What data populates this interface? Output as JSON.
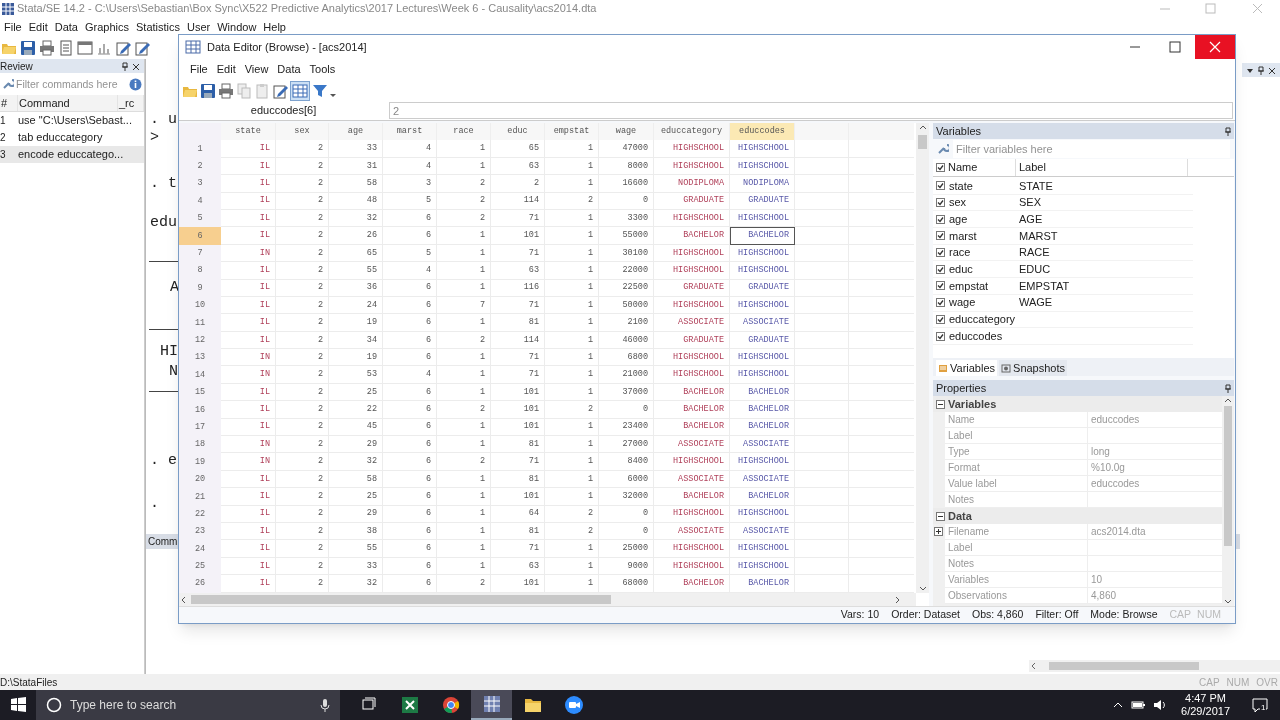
{
  "window": {
    "title": "Stata/SE 14.2 - C:\\Users\\Sebastian\\Box Sync\\X522 Predictive Analytics\\2017 Lectures\\Week 6 - Causality\\acs2014.dta",
    "menu": [
      "File",
      "Edit",
      "Data",
      "Graphics",
      "Statistics",
      "User",
      "Window",
      "Help"
    ]
  },
  "review": {
    "title": "Review",
    "filter_placeholder": "Filter commands here",
    "columns": [
      "#",
      "Command",
      "_rc"
    ],
    "items": [
      {
        "number": "1",
        "command": "use \"C:\\Users\\Sebast...",
        "selected": false
      },
      {
        "number": "2",
        "command": "tab educcategory",
        "selected": false
      },
      {
        "number": "3",
        "command": "encode educcatego...",
        "selected": true
      }
    ]
  },
  "results": {
    "lines": [
      ". u",
      ">",
      ". t",
      "edu",
      "A",
      "HI",
      "N",
      ". e",
      "."
    ],
    "command_window_title": "Comm"
  },
  "editor": {
    "title": "Data Editor (Browse) - [acs2014]",
    "menu": [
      "File",
      "Edit",
      "View",
      "Data",
      "Tools"
    ],
    "cell_reference": "educcodes[6]",
    "cell_value": "2",
    "columns": [
      {
        "name": "state",
        "kind": "string",
        "selected": false
      },
      {
        "name": "sex",
        "kind": "numeric",
        "selected": false
      },
      {
        "name": "age",
        "kind": "numeric",
        "selected": false
      },
      {
        "name": "marst",
        "kind": "numeric",
        "selected": false
      },
      {
        "name": "race",
        "kind": "numeric",
        "selected": false
      },
      {
        "name": "educ",
        "kind": "numeric",
        "selected": false
      },
      {
        "name": "empstat",
        "kind": "numeric",
        "selected": false
      },
      {
        "name": "wage",
        "kind": "numeric",
        "selected": false
      },
      {
        "name": "educcategory",
        "kind": "string",
        "selected": false
      },
      {
        "name": "educcodes",
        "kind": "labeled",
        "selected": true
      }
    ],
    "rows": [
      {
        "number": "1",
        "selected": false,
        "cells": [
          "IL",
          "2",
          "33",
          "4",
          "1",
          "65",
          "1",
          "47000",
          "HIGHSCHOOL",
          "HIGHSCHOOL"
        ]
      },
      {
        "number": "2",
        "selected": false,
        "cells": [
          "IL",
          "2",
          "31",
          "4",
          "1",
          "63",
          "1",
          "8000",
          "HIGHSCHOOL",
          "HIGHSCHOOL"
        ]
      },
      {
        "number": "3",
        "selected": false,
        "cells": [
          "IL",
          "2",
          "58",
          "3",
          "2",
          "2",
          "1",
          "16600",
          "NODIPLOMA",
          "NODIPLOMA"
        ]
      },
      {
        "number": "4",
        "selected": false,
        "cells": [
          "IL",
          "2",
          "48",
          "5",
          "2",
          "114",
          "2",
          "0",
          "GRADUATE",
          "GRADUATE"
        ]
      },
      {
        "number": "5",
        "selected": false,
        "cells": [
          "IL",
          "2",
          "32",
          "6",
          "2",
          "71",
          "1",
          "3300",
          "HIGHSCHOOL",
          "HIGHSCHOOL"
        ]
      },
      {
        "number": "6",
        "selected": true,
        "cells": [
          "IL",
          "2",
          "26",
          "6",
          "1",
          "101",
          "1",
          "55000",
          "BACHELOR",
          "BACHELOR"
        ]
      },
      {
        "number": "7",
        "selected": false,
        "cells": [
          "IN",
          "2",
          "65",
          "5",
          "1",
          "71",
          "1",
          "30100",
          "HIGHSCHOOL",
          "HIGHSCHOOL"
        ]
      },
      {
        "number": "8",
        "selected": false,
        "cells": [
          "IL",
          "2",
          "55",
          "4",
          "1",
          "63",
          "1",
          "22000",
          "HIGHSCHOOL",
          "HIGHSCHOOL"
        ]
      },
      {
        "number": "9",
        "selected": false,
        "cells": [
          "IL",
          "2",
          "36",
          "6",
          "1",
          "116",
          "1",
          "22500",
          "GRADUATE",
          "GRADUATE"
        ]
      },
      {
        "number": "10",
        "selected": false,
        "cells": [
          "IL",
          "2",
          "24",
          "6",
          "7",
          "71",
          "1",
          "50000",
          "HIGHSCHOOL",
          "HIGHSCHOOL"
        ]
      },
      {
        "number": "11",
        "selected": false,
        "cells": [
          "IL",
          "2",
          "19",
          "6",
          "1",
          "81",
          "1",
          "2100",
          "ASSOCIATE",
          "ASSOCIATE"
        ]
      },
      {
        "number": "12",
        "selected": false,
        "cells": [
          "IL",
          "2",
          "34",
          "6",
          "2",
          "114",
          "1",
          "46000",
          "GRADUATE",
          "GRADUATE"
        ]
      },
      {
        "number": "13",
        "selected": false,
        "cells": [
          "IN",
          "2",
          "19",
          "6",
          "1",
          "71",
          "1",
          "6800",
          "HIGHSCHOOL",
          "HIGHSCHOOL"
        ]
      },
      {
        "number": "14",
        "selected": false,
        "cells": [
          "IN",
          "2",
          "53",
          "4",
          "1",
          "71",
          "1",
          "21000",
          "HIGHSCHOOL",
          "HIGHSCHOOL"
        ]
      },
      {
        "number": "15",
        "selected": false,
        "cells": [
          "IL",
          "2",
          "25",
          "6",
          "1",
          "101",
          "1",
          "37000",
          "BACHELOR",
          "BACHELOR"
        ]
      },
      {
        "number": "16",
        "selected": false,
        "cells": [
          "IL",
          "2",
          "22",
          "6",
          "2",
          "101",
          "2",
          "0",
          "BACHELOR",
          "BACHELOR"
        ]
      },
      {
        "number": "17",
        "selected": false,
        "cells": [
          "IL",
          "2",
          "45",
          "6",
          "1",
          "101",
          "1",
          "23400",
          "BACHELOR",
          "BACHELOR"
        ]
      },
      {
        "number": "18",
        "selected": false,
        "cells": [
          "IN",
          "2",
          "29",
          "6",
          "1",
          "81",
          "1",
          "27000",
          "ASSOCIATE",
          "ASSOCIATE"
        ]
      },
      {
        "number": "19",
        "selected": false,
        "cells": [
          "IN",
          "2",
          "32",
          "6",
          "2",
          "71",
          "1",
          "8400",
          "HIGHSCHOOL",
          "HIGHSCHOOL"
        ]
      },
      {
        "number": "20",
        "selected": false,
        "cells": [
          "IL",
          "2",
          "58",
          "6",
          "1",
          "81",
          "1",
          "6000",
          "ASSOCIATE",
          "ASSOCIATE"
        ]
      },
      {
        "number": "21",
        "selected": false,
        "cells": [
          "IL",
          "2",
          "25",
          "6",
          "1",
          "101",
          "1",
          "32000",
          "BACHELOR",
          "BACHELOR"
        ]
      },
      {
        "number": "22",
        "selected": false,
        "cells": [
          "IL",
          "2",
          "29",
          "6",
          "1",
          "64",
          "2",
          "0",
          "HIGHSCHOOL",
          "HIGHSCHOOL"
        ]
      },
      {
        "number": "23",
        "selected": false,
        "cells": [
          "IL",
          "2",
          "38",
          "6",
          "1",
          "81",
          "2",
          "0",
          "ASSOCIATE",
          "ASSOCIATE"
        ]
      },
      {
        "number": "24",
        "selected": false,
        "cells": [
          "IL",
          "2",
          "55",
          "6",
          "1",
          "71",
          "1",
          "25000",
          "HIGHSCHOOL",
          "HIGHSCHOOL"
        ]
      },
      {
        "number": "25",
        "selected": false,
        "cells": [
          "IL",
          "2",
          "33",
          "6",
          "1",
          "63",
          "1",
          "9000",
          "HIGHSCHOOL",
          "HIGHSCHOOL"
        ]
      },
      {
        "number": "26",
        "selected": false,
        "cells": [
          "IL",
          "2",
          "32",
          "6",
          "2",
          "101",
          "1",
          "68000",
          "BACHELOR",
          "BACHELOR"
        ]
      }
    ],
    "status": [
      "Vars: 10",
      "Order: Dataset",
      "Obs: 4,860",
      "Filter: Off",
      "Mode: Browse"
    ],
    "indicators": [
      {
        "label": "CAP",
        "on": false
      },
      {
        "label": "NUM",
        "on": false
      }
    ]
  },
  "variables": {
    "title": "Variables",
    "filter_placeholder": "Filter variables here",
    "all_checked": true,
    "columns": [
      "Name",
      "Label"
    ],
    "items": [
      {
        "name": "state",
        "label": "STATE",
        "checked": true
      },
      {
        "name": "sex",
        "label": "SEX",
        "checked": true
      },
      {
        "name": "age",
        "label": "AGE",
        "checked": true
      },
      {
        "name": "marst",
        "label": "MARST",
        "checked": true
      },
      {
        "name": "race",
        "label": "RACE",
        "checked": true
      },
      {
        "name": "educ",
        "label": "EDUC",
        "checked": true
      },
      {
        "name": "empstat",
        "label": "EMPSTAT",
        "checked": true
      },
      {
        "name": "wage",
        "label": "WAGE",
        "checked": true
      },
      {
        "name": "educcategory",
        "checked": true
      },
      {
        "name": "educcodes",
        "checked": true
      }
    ],
    "tabs": [
      {
        "label": "Variables",
        "selected": true
      },
      {
        "label": "Snapshots",
        "selected": false
      }
    ]
  },
  "properties": {
    "title": "Properties",
    "sections": [
      {
        "title": "Variables",
        "expanded": true,
        "rows": [
          {
            "key": "Name",
            "value": "educcodes"
          },
          {
            "key": "Label"
          },
          {
            "key": "Type",
            "value": "long"
          },
          {
            "key": "Format",
            "value": "%10.0g"
          },
          {
            "key": "Value label",
            "value": "educcodes"
          },
          {
            "key": "Notes"
          }
        ]
      },
      {
        "title": "Data",
        "expanded": true,
        "rows": [
          {
            "key": "Filename",
            "value": "acs2014.dta",
            "expandable": true
          },
          {
            "key": "Label"
          },
          {
            "key": "Notes"
          },
          {
            "key": "Variables",
            "value": "10"
          },
          {
            "key": "Observations",
            "value": "4,860"
          }
        ]
      }
    ]
  },
  "status_bar": {
    "path": "D:\\StataFiles",
    "indicators": [
      {
        "label": "CAP",
        "on": false
      },
      {
        "label": "NUM",
        "on": false
      },
      {
        "label": "OVR",
        "on": false
      }
    ]
  },
  "taskbar": {
    "search_placeholder": "Type here to search",
    "apps": [
      {
        "kind": "task-view",
        "selected": false
      },
      {
        "kind": "spreadsheet",
        "selected": false
      },
      {
        "kind": "browser",
        "selected": false
      },
      {
        "kind": "stata",
        "selected": true
      },
      {
        "kind": "folder",
        "selected": false
      },
      {
        "kind": "video",
        "selected": false
      }
    ],
    "time": "4:47 PM",
    "date": "6/29/2017",
    "notifications": "1"
  }
}
